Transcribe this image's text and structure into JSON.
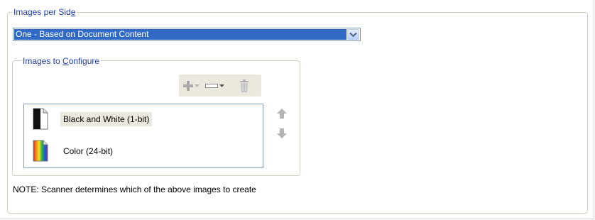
{
  "images_per_side": {
    "legend_prefix": "Images per Sid",
    "legend_mnemonic": "e",
    "selected_option": "One - Based on Document Content"
  },
  "images_to_configure": {
    "legend_prefix": "Images to ",
    "legend_mnemonic": "C",
    "legend_suffix": "onfigure",
    "toolbar": {
      "add_icon": "plus-icon",
      "add_dropdown_icon": "chevron-down-icon",
      "change_icon": "rectangle-icon",
      "change_dropdown_icon": "chevron-down-icon",
      "delete_icon": "trash-icon"
    },
    "items": [
      {
        "label": "Black and White (1-bit)",
        "icon": "bw-document-icon",
        "selected": true
      },
      {
        "label": "Color (24-bit)",
        "icon": "color-document-icon",
        "selected": false
      }
    ],
    "move_up_icon": "arrow-up-icon",
    "move_down_icon": "arrow-down-icon"
  },
  "note": "NOTE: Scanner determines which of the above images to create",
  "colors": {
    "legend": "#1f3ea8",
    "selection": "#316ac5",
    "item_highlight": "#ebe9dd",
    "disabled_icon": "#a8a8a8"
  }
}
